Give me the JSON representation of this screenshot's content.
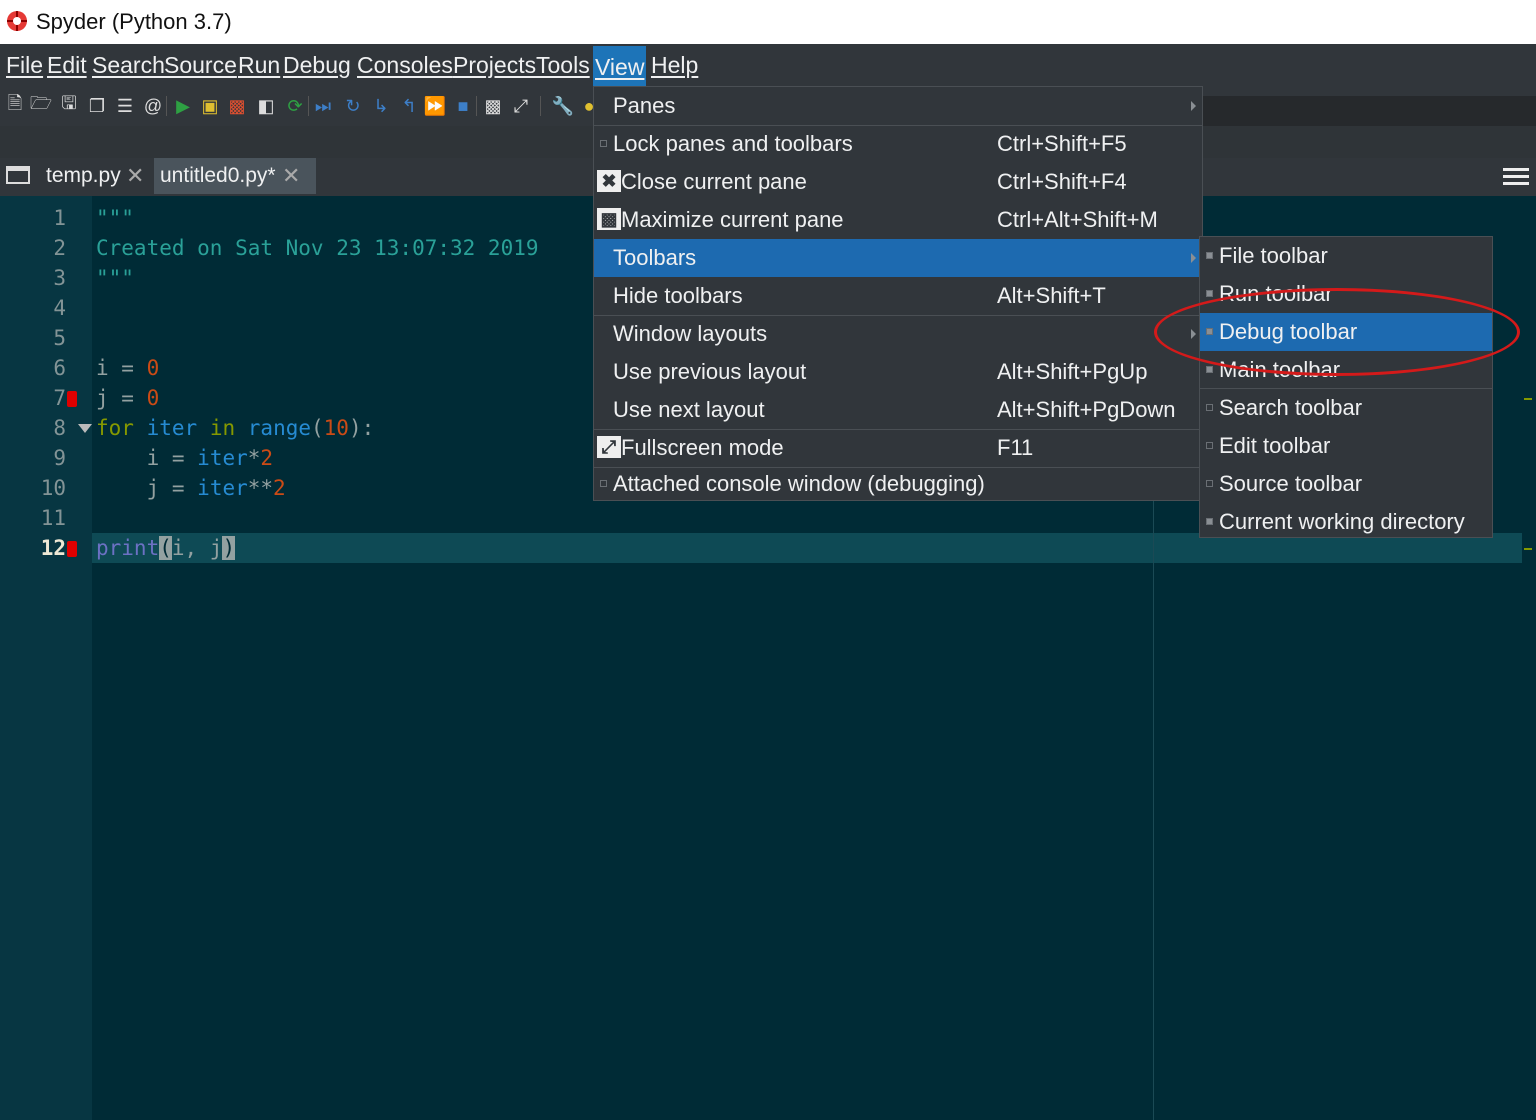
{
  "window": {
    "title": "Spyder (Python 3.7)",
    "icon": "spyder-logo-icon"
  },
  "menubar": [
    "File",
    "Edit",
    "Search",
    "Source",
    "Run",
    "Debug",
    "Consoles",
    "Projects",
    "Tools",
    "View",
    "Help"
  ],
  "menubar_active": "View",
  "toolbar_icons": [
    "new-file-icon",
    "open-file-icon",
    "save-icon",
    "save-all-icon",
    "list-icon",
    "at-icon",
    "run-icon",
    "run-cell-icon",
    "run-cell-advance-icon",
    "run-selection-icon",
    "re-run-icon",
    "debug-icon",
    "step-icon",
    "step-into-icon",
    "step-return-icon",
    "continue-icon",
    "stop-icon",
    "maximize-pane-icon",
    "fullscreen-icon",
    "preferences-icon",
    "python-icon"
  ],
  "tabs": [
    {
      "label": "temp.py",
      "active": false
    },
    {
      "label": "untitled0.py*",
      "active": true
    }
  ],
  "editor": {
    "line_numbers": [
      "1",
      "2",
      "3",
      "4",
      "5",
      "6",
      "7",
      "8",
      "9",
      "10",
      "11",
      "12"
    ],
    "current_line": "12",
    "breakpoint_lines": [
      "7",
      "12"
    ],
    "code": {
      "l1": "\"\"\"",
      "l2": "Created on Sat Nov 23 13:07:32 2019",
      "l3": "\"\"\"",
      "l6_var": "i",
      "l6_op": " = ",
      "l6_num": "0",
      "l7_var": "j",
      "l7_op": " = ",
      "l7_num": "0",
      "l8_for": "for",
      "l8_iter": "iter",
      "l8_in": "in",
      "l8_range": "range",
      "l8_open": "(",
      "l8_num": "10",
      "l8_close": "):",
      "l9_var": "i",
      "l9_op": " = ",
      "l9_iter": "iter",
      "l9_mul": "*",
      "l9_num": "2",
      "l10_var": "j",
      "l10_op": " = ",
      "l10_iter": "iter",
      "l10_pow": "**",
      "l10_num": "2",
      "l12_fn": "print",
      "l12_open": "(",
      "l12_args": "i, j",
      "l12_close": ")"
    }
  },
  "view_menu": {
    "items": [
      {
        "label": "Panes",
        "shortcut": "",
        "submenu": true
      },
      {
        "label": "Lock panes and toolbars",
        "shortcut": "Ctrl+Shift+F5"
      },
      {
        "label": "Close current pane",
        "shortcut": "Ctrl+Shift+F4"
      },
      {
        "label": "Maximize current pane",
        "shortcut": "Ctrl+Alt+Shift+M"
      },
      {
        "label": "Toolbars",
        "shortcut": "",
        "submenu": true,
        "selected": true
      },
      {
        "label": "Hide toolbars",
        "shortcut": "Alt+Shift+T"
      },
      {
        "label": "Window layouts",
        "shortcut": "",
        "submenu": true
      },
      {
        "label": "Use previous layout",
        "shortcut": "Alt+Shift+PgUp"
      },
      {
        "label": "Use next layout",
        "shortcut": "Alt+Shift+PgDown"
      },
      {
        "label": "Fullscreen mode",
        "shortcut": "F11"
      },
      {
        "label": "Attached console window (debugging)",
        "shortcut": ""
      }
    ]
  },
  "toolbars_submenu": {
    "items": [
      {
        "label": "File toolbar",
        "checked": true
      },
      {
        "label": "Run toolbar",
        "checked": true
      },
      {
        "label": "Debug toolbar",
        "checked": true,
        "selected": true
      },
      {
        "label": "Main toolbar",
        "checked": true
      },
      {
        "label": "Search toolbar",
        "checked": false
      },
      {
        "label": "Edit toolbar",
        "checked": false
      },
      {
        "label": "Source toolbar",
        "checked": false
      },
      {
        "label": "Current working directory",
        "checked": true
      }
    ]
  },
  "colors": {
    "accent": "#1d6ab0",
    "annotation": "#d41a1a",
    "editor_bg": "#002b36",
    "menu_bg": "#31363b"
  }
}
